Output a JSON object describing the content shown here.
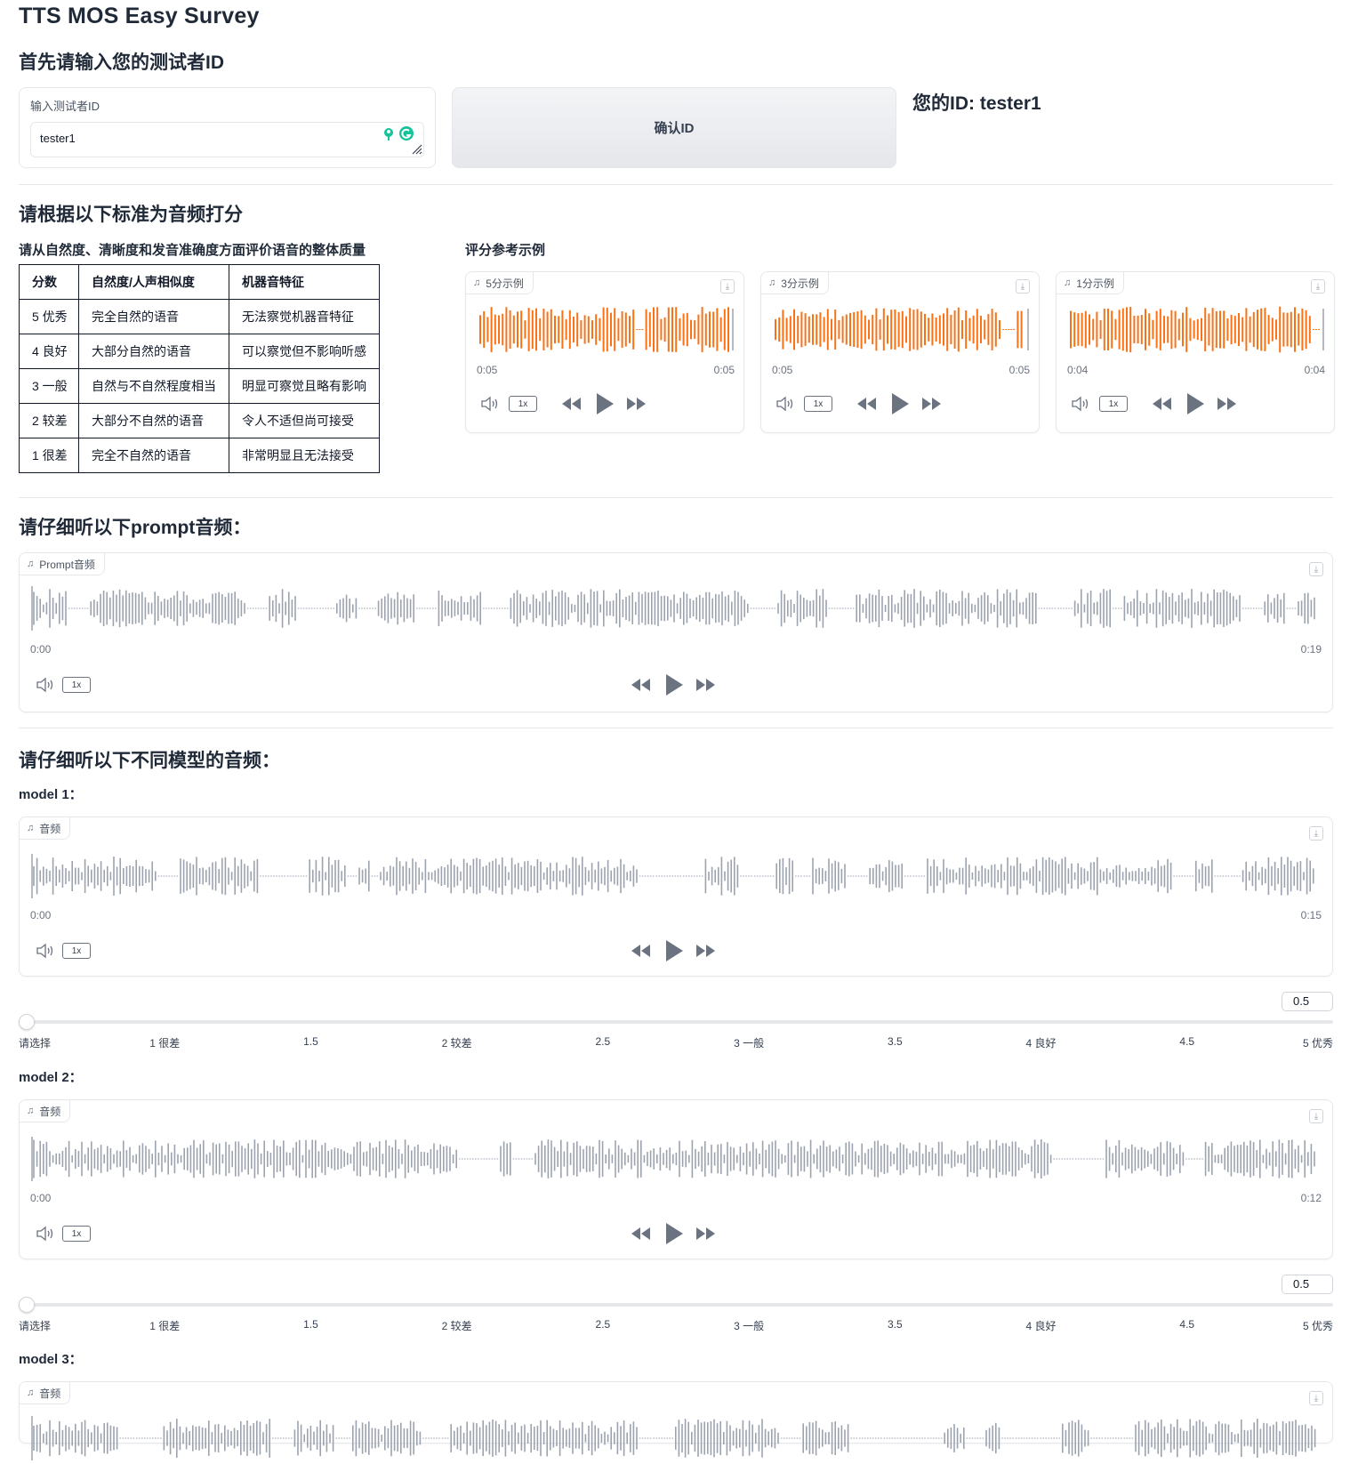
{
  "page": {
    "title": "TTS MOS Easy Survey",
    "id_heading": "首先请输入您的测试者ID",
    "criteria_heading": "请根据以下标准为音频打分",
    "prompt_heading": "请仔细听以下prompt音频：",
    "models_heading": "请仔细听以下不同模型的音频："
  },
  "id_input": {
    "label": "输入测试者ID",
    "value": "tester1",
    "confirm_label": "确认ID",
    "your_id": "您的ID: tester1"
  },
  "criteria": {
    "subtitle": "请从自然度、清晰度和发音准确度方面评价语音的整体质量",
    "headers": [
      "分数",
      "自然度/人声相似度",
      "机器音特征"
    ],
    "rows": [
      [
        "5 优秀",
        "完全自然的语音",
        "无法察觉机器音特征"
      ],
      [
        "4 良好",
        "大部分自然的语音",
        "可以察觉但不影响听感"
      ],
      [
        "3 一般",
        "自然与不自然程度相当",
        "明显可察觉且略有影响"
      ],
      [
        "2 较差",
        "大部分不自然的语音",
        "令人不适但尚可接受"
      ],
      [
        "1 很差",
        "完全不自然的语音",
        "非常明显且无法接受"
      ]
    ]
  },
  "examples": {
    "heading": "评分参考示例",
    "items": [
      {
        "label": "5分示例",
        "time_current": "0:05",
        "time_total": "0:05",
        "rate": "1x"
      },
      {
        "label": "3分示例",
        "time_current": "0:05",
        "time_total": "0:05",
        "rate": "1x"
      },
      {
        "label": "1分示例",
        "time_current": "0:04",
        "time_total": "0:04",
        "rate": "1x"
      }
    ],
    "wave_color": "#f97316"
  },
  "prompt_audio": {
    "label": "Prompt音频",
    "time_current": "0:00",
    "time_total": "0:19",
    "rate": "1x"
  },
  "models": [
    {
      "title": "model 1：",
      "audio_label": "音频",
      "time_current": "0:00",
      "time_total": "0:15",
      "rate": "1x",
      "score": "0.5"
    },
    {
      "title": "model 2：",
      "audio_label": "音频",
      "time_current": "0:00",
      "time_total": "0:12",
      "rate": "1x",
      "score": "0.5"
    },
    {
      "title": "model 3：",
      "audio_label": "音频"
    }
  ],
  "slider_ticks": [
    "请选择",
    "1 很差",
    "1.5",
    "2 较差",
    "2.5",
    "3 一般",
    "3.5",
    "4 良好",
    "4.5",
    "5 优秀"
  ],
  "colors": {
    "wave_gray": "#9ca3af",
    "accent_orange": "#f97316",
    "grammarly_green": "#15c39a"
  },
  "icons": [
    "music-note-icon",
    "download-icon",
    "volume-icon",
    "rewind-icon",
    "play-icon",
    "fast-forward-icon",
    "grammarly-icon",
    "resize-handle-icon"
  ]
}
